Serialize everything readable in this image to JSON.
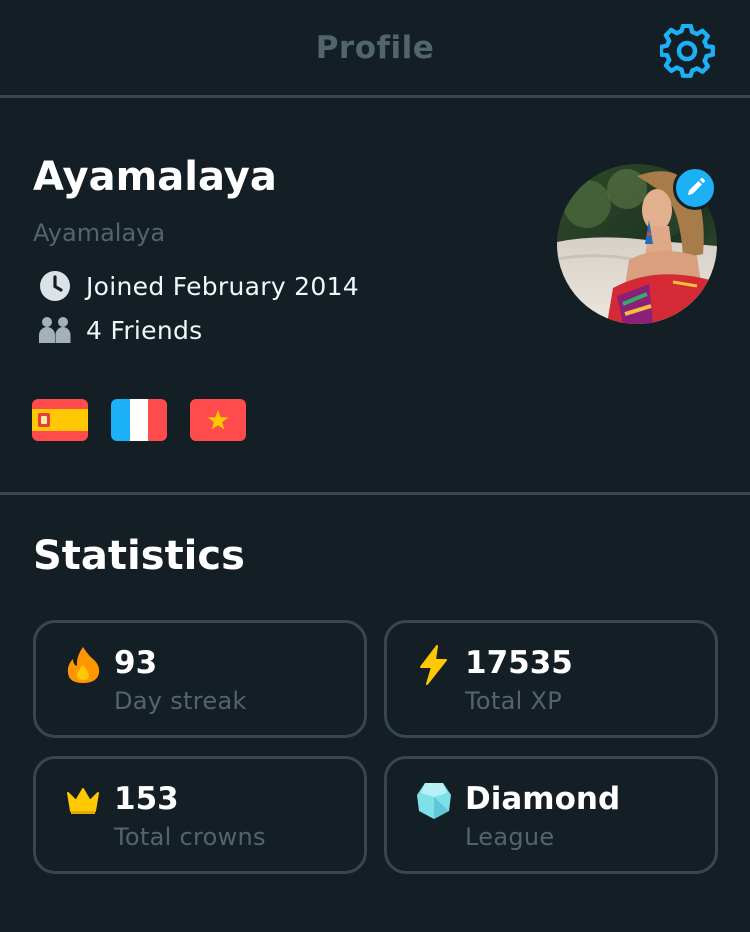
{
  "header": {
    "title": "Profile",
    "settings_icon": "gear-icon"
  },
  "profile": {
    "name": "Ayamalaya",
    "username": "Ayamalaya",
    "joined": "Joined February 2014",
    "friends": "4 Friends",
    "languages": [
      "Spanish flag",
      "French flag",
      "Vietnamese flag"
    ]
  },
  "statistics": {
    "heading": "Statistics",
    "items": [
      {
        "value": "93",
        "label": "Day streak",
        "icon": "flame-icon"
      },
      {
        "value": "17535",
        "label": "Total XP",
        "icon": "lightning-icon"
      },
      {
        "value": "153",
        "label": "Total crowns",
        "icon": "crown-icon"
      },
      {
        "value": "Diamond",
        "label": "League",
        "icon": "diamond-league-icon"
      }
    ]
  },
  "colors": {
    "background": "#131f24",
    "border": "#37464f",
    "muted_text": "#52656d",
    "accent_blue": "#1cb0f6",
    "streak_orange": "#ff9600",
    "xp_yellow": "#ffc800",
    "diamond_cyan": "#7ee0e8"
  }
}
